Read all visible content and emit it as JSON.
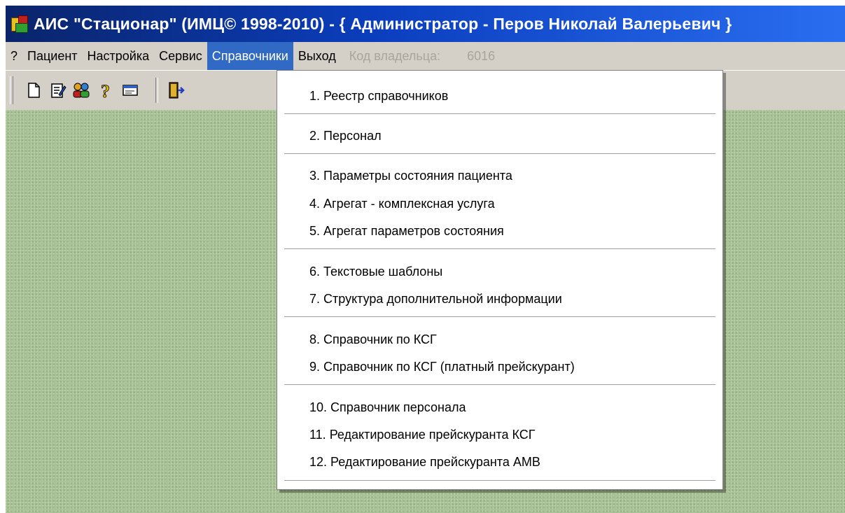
{
  "window": {
    "title": "АИС \"Стационар\"  (ИМЦ© 1998-2010) - { Администратор - Перов Николай Валерьевич }"
  },
  "menubar": {
    "items": [
      {
        "label": "?"
      },
      {
        "label": "Пациент"
      },
      {
        "label": "Настройка"
      },
      {
        "label": "Сервис"
      },
      {
        "label": "Справочники",
        "active": true
      },
      {
        "label": "Выход"
      }
    ],
    "owner_label": "Код владельца:",
    "owner_value": "6016"
  },
  "toolbar": {
    "buttons": [
      "new-document-icon",
      "edit-document-icon",
      "users-icon",
      "help-icon",
      "card-icon",
      "exit-door-icon"
    ]
  },
  "dropdown": {
    "items": [
      {
        "label": "1. Реестр справочников"
      },
      {
        "label": "2. Персонал"
      },
      {
        "label": "3. Параметры состояния пациента"
      },
      {
        "label": "4. Агрегат - комплексная услуга"
      },
      {
        "label": "5. Агрегат параметров состояния"
      },
      {
        "label": "6. Текстовые шаблоны"
      },
      {
        "label": "7. Структура дополнительной информации"
      },
      {
        "label": "8. Справочник по КСГ"
      },
      {
        "label": "9. Справочник по КСГ (платный прейскурант)"
      },
      {
        "label": "10. Справочник персонала"
      },
      {
        "label": "11. Редактирование прейскуранта КСГ"
      },
      {
        "label": "12. Редактирование прейскуранта АМВ"
      }
    ]
  },
  "colors": {
    "titlebar": "#0b3fbf",
    "menu_highlight": "#316ac5",
    "workspace": "#a9c397"
  }
}
